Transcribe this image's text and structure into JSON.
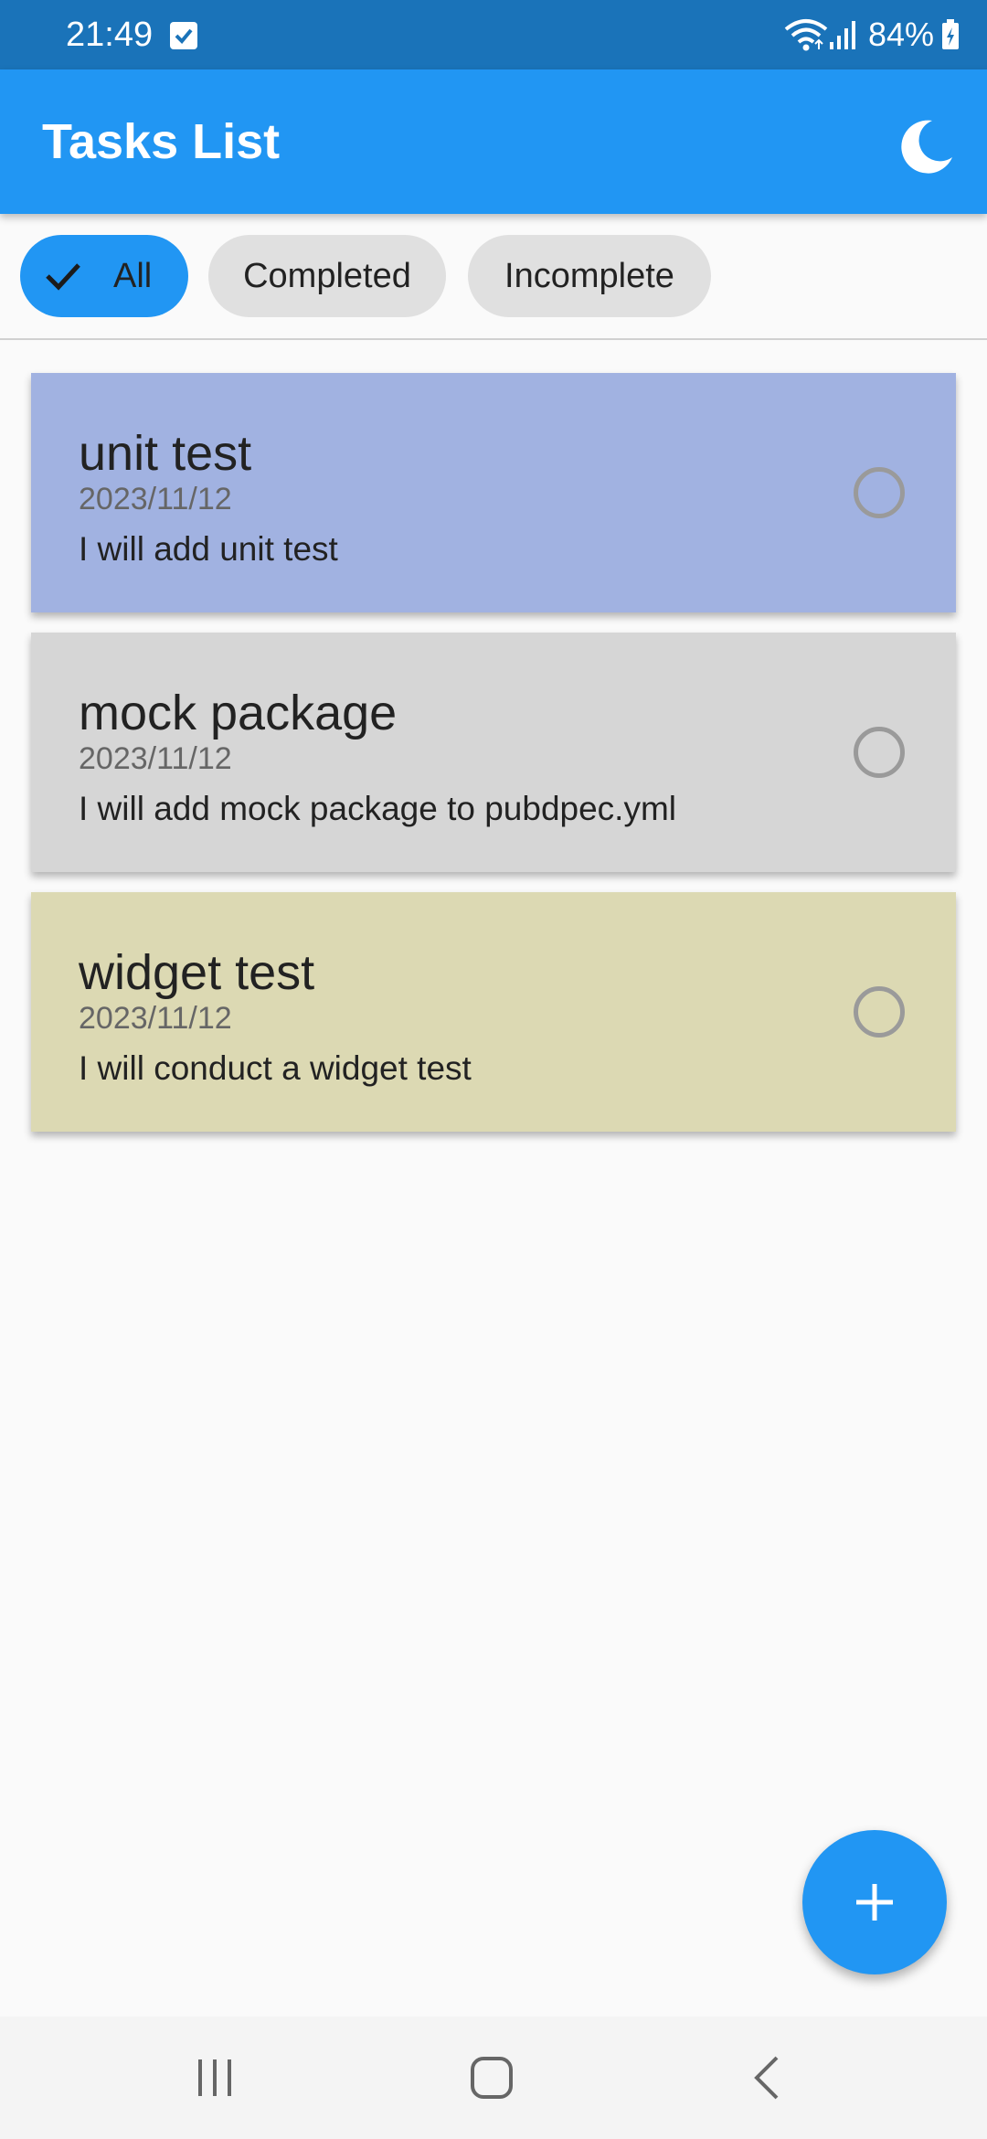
{
  "status_bar": {
    "time": "21:49",
    "battery": "84%",
    "icons": [
      "checkbox-notification-icon",
      "wifi-icon",
      "signal-icon",
      "battery-charging-icon"
    ]
  },
  "app_bar": {
    "title": "Tasks List",
    "theme_icon": "moon-icon",
    "color": "#2196f3"
  },
  "filters": {
    "all": "All",
    "completed": "Completed",
    "incomplete": "Incomplete",
    "selected": "All"
  },
  "tasks": [
    {
      "title": "unit test",
      "date": "2023/11/12",
      "description": "I will add unit test",
      "color": "#a1b2e1",
      "completed": false
    },
    {
      "title": "mock package",
      "date": "2023/11/12",
      "description": "I will add mock package to pubdpec.yml",
      "color": "#d6d6d6",
      "completed": false
    },
    {
      "title": "widget test",
      "date": "2023/11/12",
      "description": "I will conduct a widget test",
      "color": "#dcd9b3",
      "completed": false
    }
  ],
  "fab": {
    "icon": "plus-icon"
  },
  "nav_bar": {
    "icons": [
      "recent-apps-icon",
      "home-icon",
      "back-icon"
    ]
  }
}
